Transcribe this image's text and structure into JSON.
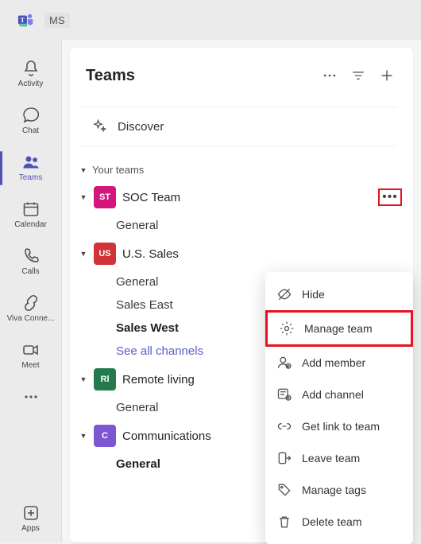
{
  "titlebar": {
    "ms": "MS"
  },
  "rail": {
    "items": [
      {
        "label": "Activity"
      },
      {
        "label": "Chat"
      },
      {
        "label": "Teams"
      },
      {
        "label": "Calendar"
      },
      {
        "label": "Calls"
      },
      {
        "label": "Viva Conne..."
      },
      {
        "label": "Meet"
      }
    ],
    "apps": "Apps"
  },
  "header": {
    "title": "Teams",
    "discover": "Discover"
  },
  "section": {
    "your_teams": "Your teams"
  },
  "teams": [
    {
      "initials": "ST",
      "name": "SOC Team",
      "color": "#d4157d",
      "show_more": true,
      "channels": [
        {
          "label": "General",
          "active": true
        }
      ]
    },
    {
      "initials": "US",
      "name": "U.S. Sales",
      "color": "#d13438",
      "channels": [
        {
          "label": "General"
        },
        {
          "label": "Sales East"
        },
        {
          "label": "Sales West",
          "bold": true
        },
        {
          "label": "See all channels",
          "link": true
        }
      ]
    },
    {
      "initials": "Rl",
      "name": "Remote living",
      "color": "#237b4b",
      "channels": [
        {
          "label": "General"
        }
      ]
    },
    {
      "initials": "C",
      "name": "Communications",
      "color": "#7d57d1",
      "channels": [
        {
          "label": "General",
          "bold": true
        }
      ]
    }
  ],
  "menu": {
    "hide": "Hide",
    "manage": "Manage team",
    "add_member": "Add member",
    "add_channel": "Add channel",
    "get_link": "Get link to team",
    "leave": "Leave team",
    "tags": "Manage tags",
    "delete": "Delete team"
  }
}
